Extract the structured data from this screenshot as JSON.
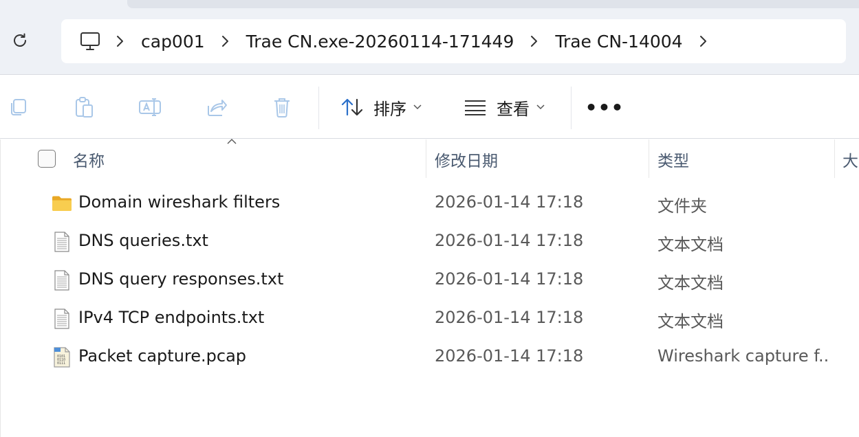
{
  "address_bar": {
    "refresh_icon": "refresh-icon",
    "computer_icon": "computer-icon",
    "breadcrumbs": [
      "cap001",
      "Trae CN.exe-20260114-171449",
      "Trae CN-14004"
    ]
  },
  "toolbar": {
    "copy_icon": "copy-icon",
    "paste_icon": "paste-icon",
    "rename_icon": "rename-icon",
    "share_icon": "share-icon",
    "delete_icon": "delete-icon",
    "sort_label": "排序",
    "view_label": "查看",
    "more_label": "•••"
  },
  "columns": {
    "name": "名称",
    "date": "修改日期",
    "type": "类型",
    "size": "大"
  },
  "files": [
    {
      "name": "Domain wireshark filters",
      "date": "2026-01-14 17:18",
      "type": "文件夹",
      "icon": "folder-icon"
    },
    {
      "name": "DNS queries.txt",
      "date": "2026-01-14 17:18",
      "type": "文本文档",
      "icon": "text-file-icon"
    },
    {
      "name": "DNS query responses.txt",
      "date": "2026-01-14 17:18",
      "type": "文本文档",
      "icon": "text-file-icon"
    },
    {
      "name": "IPv4 TCP endpoints.txt",
      "date": "2026-01-14 17:18",
      "type": "文本文档",
      "icon": "text-file-icon"
    },
    {
      "name": "Packet capture.pcap",
      "date": "2026-01-14 17:18",
      "type": "Wireshark capture f...",
      "icon": "pcap-file-icon"
    }
  ],
  "colors": {
    "accent": "#2a6fc9",
    "folder": "#f6c445",
    "toolbar_disabled": "#a9c7e8"
  }
}
